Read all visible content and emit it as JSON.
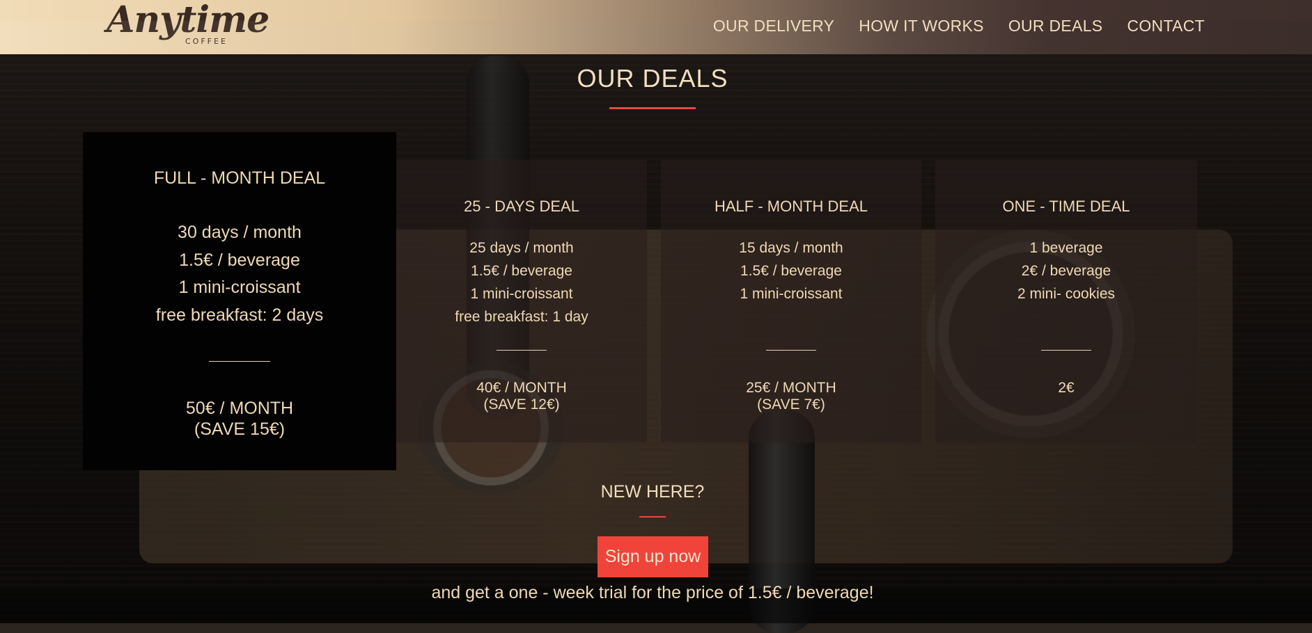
{
  "header": {
    "logo_text": "Anytime",
    "logo_sub": "COFFEE",
    "nav": [
      {
        "label": "OUR DELIVERY"
      },
      {
        "label": "HOW IT WORKS"
      },
      {
        "label": "OUR DEALS"
      },
      {
        "label": "CONTACT"
      }
    ]
  },
  "deals": {
    "title": "OUR DEALS",
    "cards": [
      {
        "title": "FULL - MONTH DEAL",
        "lines": [
          "30 days / month",
          "1.5€ / beverage",
          "1 mini-croissant",
          "free breakfast: 2 days"
        ],
        "price1": "50€ / MONTH",
        "price2": "(SAVE 15€)"
      },
      {
        "title": "25 - DAYS DEAL",
        "lines": [
          "25 days / month",
          "1.5€ / beverage",
          "1 mini-croissant",
          "free breakfast: 1 day"
        ],
        "price1": "40€ / MONTH",
        "price2": "(SAVE 12€)"
      },
      {
        "title": "HALF - MONTH DEAL",
        "lines": [
          "15 days / month",
          "1.5€ / beverage",
          "1 mini-croissant"
        ],
        "price1": "25€ / MONTH",
        "price2": "(SAVE 7€)"
      },
      {
        "title": "ONE - TIME DEAL",
        "lines": [
          "1 beverage",
          "2€ / beverage",
          "2 mini- cookies"
        ],
        "price1": "2€",
        "price2": ""
      }
    ]
  },
  "newhere": {
    "title": "NEW HERE?",
    "button": "Sign up now",
    "trial_text": "and get a one - week trial for the price of 1.5€ / beverage!"
  },
  "colors": {
    "accent": "#f0443a",
    "text": "#f0d9b5"
  }
}
